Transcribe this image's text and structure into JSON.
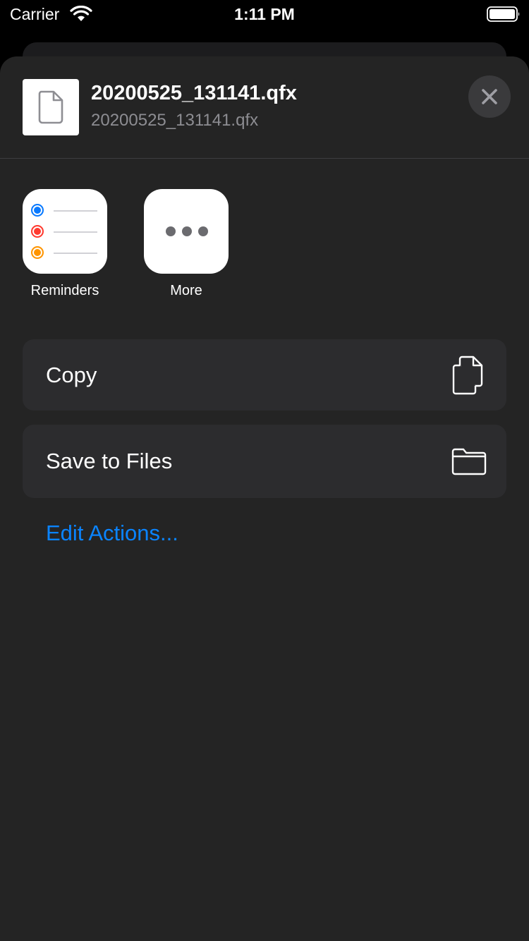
{
  "status_bar": {
    "carrier": "Carrier",
    "time": "1:11 PM",
    "wifi_icon": "wifi-icon",
    "battery_icon": "battery-icon"
  },
  "share_sheet": {
    "file_title": "20200525_131141.qfx",
    "file_subtitle": "20200525_131141.qfx",
    "file_icon": "document-icon",
    "close_icon": "close-icon",
    "apps": [
      {
        "label": "Reminders",
        "icon": "reminders-icon"
      },
      {
        "label": "More",
        "icon": "ellipsis-icon"
      }
    ],
    "actions": [
      {
        "label": "Copy",
        "icon": "copy-icon"
      },
      {
        "label": "Save to Files",
        "icon": "folder-icon"
      }
    ],
    "edit_actions_label": "Edit Actions..."
  },
  "colors": {
    "sheet_background": "#242424",
    "row_background": "#2c2c2e",
    "link_blue": "#0a84ff",
    "reminder_blue": "#0a7aff",
    "reminder_red": "#ff3b30",
    "reminder_orange": "#ff9500"
  }
}
